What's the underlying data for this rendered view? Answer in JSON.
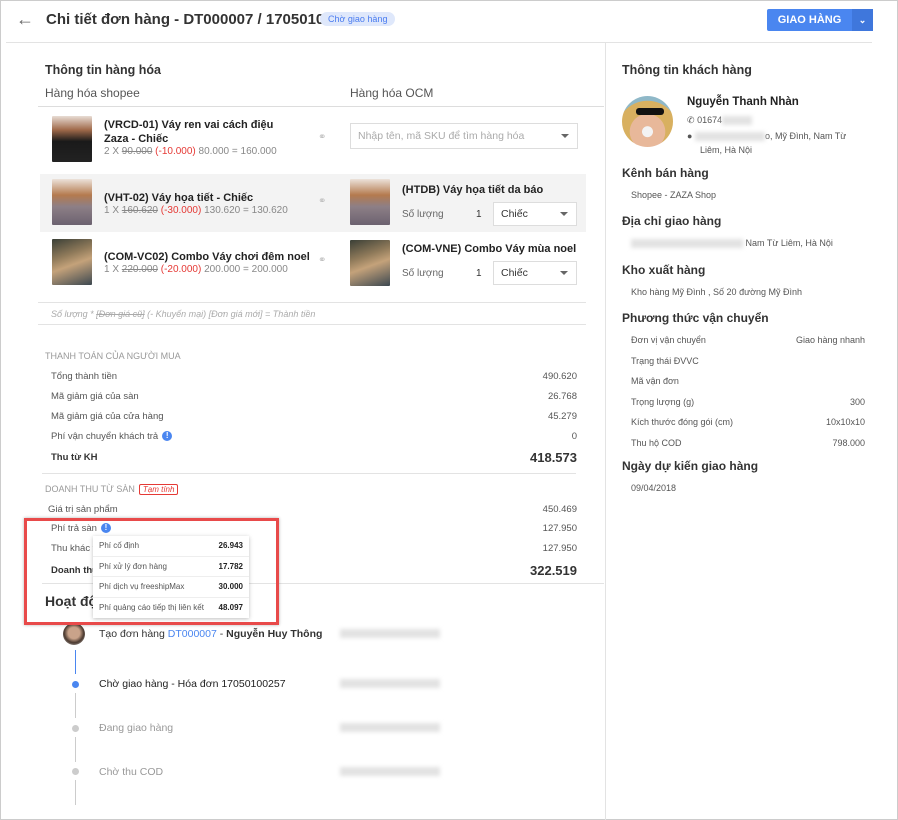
{
  "header": {
    "title": "Chi tiết đơn hàng - DT000007 / 17050100255",
    "status_badge": "Chờ giao hàng",
    "deliver_button": "GIAO HÀNG"
  },
  "products": {
    "section_title": "Thông tin hàng hóa",
    "col_shopee": "Hàng hóa shopee",
    "col_ocm": "Hàng hóa OCM",
    "qty_label": "Số lượng",
    "rows": [
      {
        "shopee_name": "(VRCD-01) Váy ren vai cách điệu Zaza - Chiếc",
        "qty": "2 X",
        "old_price": "90.000",
        "discount": "(-10.000)",
        "result": "80.000 = 160.000",
        "ocm_placeholder": "Nhập tên, mã SKU để tìm hàng hóa"
      },
      {
        "shopee_name": "(VHT-02) Váy họa tiết - Chiếc",
        "qty": "1 X",
        "old_price": "160.620",
        "discount": "(-30.000)",
        "result": "130.620 = 130.620",
        "ocm_name": "(HTDB) Váy họa tiết da báo",
        "ocm_qty": "1",
        "ocm_unit": "Chiếc"
      },
      {
        "shopee_name": "(COM-VC02) Combo Váy chơi đêm noel",
        "qty": "1 X",
        "old_price": "220.000",
        "discount": "(-20.000)",
        "result": "200.000 = 200.000",
        "ocm_name": "(COM-VNE) Combo Váy mùa noel",
        "ocm_qty": "1",
        "ocm_unit": "Chiếc"
      }
    ],
    "formula_prefix": "Số lượng * ",
    "formula_old": "[Đơn giá cũ]",
    "formula_rest": " (- Khuyến mại) [Đơn giá mới] = Thành tiền"
  },
  "buyer_payment": {
    "caption": "THANH TOÁN CỦA NGƯỜI MUA",
    "rows": [
      {
        "label": "Tổng thành tiền",
        "value": "490.620"
      },
      {
        "label": "Mã giảm giá của sàn",
        "value": "26.768"
      },
      {
        "label": "Mã giảm giá của cửa hàng",
        "value": "45.279"
      },
      {
        "label": "Phí vận chuyển khách trả",
        "value": "0"
      }
    ],
    "total_label": "Thu từ KH",
    "total_value": "418.573"
  },
  "marketplace_revenue": {
    "caption": "DOANH THU TỪ SÀN",
    "tag": "Tạm tính",
    "rows": [
      {
        "label": "Giá trị sản phẩm",
        "value": "450.469"
      },
      {
        "label": "Phí trả sàn",
        "value": "127.950"
      },
      {
        "label": "Thu khác từ sàn",
        "value": "127.950"
      }
    ],
    "total_label": "Doanh thu",
    "total_value": "322.519"
  },
  "fee_tooltip": [
    {
      "label": "Phí cố định",
      "value": "26.943"
    },
    {
      "label": "Phí xử lý đơn hàng",
      "value": "17.782"
    },
    {
      "label": "Phí dịch vụ freeshipMax",
      "value": "30.000"
    },
    {
      "label": "Phí quảng cáo tiếp thị liên kết",
      "value": "48.097"
    }
  ],
  "activity": {
    "title": "Hoạt động",
    "items": [
      {
        "prefix": "Tạo đơn hàng ",
        "link": "DT000007",
        "sep": " - ",
        "user": "Nguyễn Huy Thông"
      },
      {
        "text": "Chờ giao hàng - Hóa đơn 17050100257"
      },
      {
        "text": "Đang giao hàng"
      },
      {
        "text": "Chờ thu COD"
      }
    ]
  },
  "customer": {
    "section_title": "Thông tin khách hàng",
    "name": "Nguyễn Thanh Nhàn",
    "phone": "01674",
    "address_tail": "o, Mỹ Đình, Nam Từ",
    "address_line2": "Liêm, Hà Nội",
    "channel_title": "Kênh bán hàng",
    "channel": "Shopee - ZAZA Shop",
    "shipping_addr_title": "Địa chỉ giao hàng",
    "shipping_addr": "Nam Từ Liêm, Hà Nội",
    "warehouse_title": "Kho xuất hàng",
    "warehouse": "Kho hàng Mỹ Đình , Số 20 đường Mỹ Đình",
    "shipping_title": "Phương thức vận chuyển",
    "shipping_rows": [
      {
        "label": "Đơn vị vận chuyển",
        "value": "Giao hàng nhanh"
      },
      {
        "label": "Trạng thái ĐVVC",
        "value": ""
      },
      {
        "label": "Mã vận đơn",
        "value": ""
      },
      {
        "label": "Trọng lượng (g)",
        "value": "300"
      },
      {
        "label": "Kích thước đóng gói (cm)",
        "value": "10x10x10"
      },
      {
        "label": "Thu hộ COD",
        "value": "798.000"
      }
    ],
    "eta_title": "Ngày dự kiến giao hàng",
    "eta": "09/04/2018"
  }
}
